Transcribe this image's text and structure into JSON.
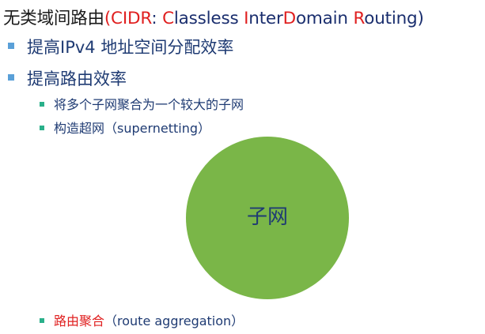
{
  "title": {
    "prefix": "无类域间路由",
    "open": "(",
    "c1": "C",
    "c1_rest": "IDR",
    "sep": ": ",
    "w1_cap": "C",
    "w1_rest": "lassless ",
    "w2_cap": "I",
    "w2_mid": "nter",
    "w2_cap2": "D",
    "w2_rest": "omain ",
    "w3_cap": "R",
    "w3_rest": "outing",
    "close": ")"
  },
  "bullets": [
    {
      "level": 1,
      "text": "提高IPv4 地址空间分配效率"
    },
    {
      "level": 1,
      "text": "提高路由效率"
    }
  ],
  "sub_bullets": [
    {
      "level": 2,
      "text": "将多个子网聚合为一个较大的子网"
    },
    {
      "level": 2,
      "text": "构造超网（supernetting）"
    }
  ],
  "circle": {
    "label": "子网",
    "color": "#7ab648"
  },
  "bottom_bullet": {
    "red_text": "路由聚合",
    "rest_text": "（route aggregation）"
  },
  "colors": {
    "heading_blue": "#1f3b73",
    "accent_red": "#e02020",
    "l1_marker": "#5aa0d8",
    "l2_marker": "#2ab08a"
  }
}
